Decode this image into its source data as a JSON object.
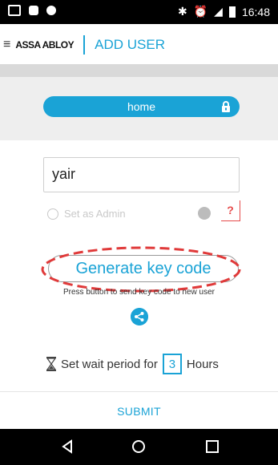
{
  "status_bar": {
    "time": "16:48",
    "icons": [
      "screen-icon",
      "app-icon",
      "circle-icon",
      "bluetooth-icon",
      "alarm-icon",
      "signal-icon",
      "battery-icon"
    ]
  },
  "header": {
    "brand": "ASSA ABLOY",
    "title": "ADD USER"
  },
  "lock_pill": {
    "label": "home",
    "icon": "lock-icon"
  },
  "user_field": {
    "value": "yair"
  },
  "admin_option": {
    "label": "Set as Admin",
    "help": "?"
  },
  "generate": {
    "label": "Generate key code",
    "hint": "Press button to send key code to new user"
  },
  "wait_period": {
    "prefix": "Set wait period for",
    "value": "3",
    "suffix": "Hours"
  },
  "submit": {
    "label": "SUBMIT"
  },
  "colors": {
    "accent": "#1aa3d6",
    "annotation": "#e03a3a"
  }
}
